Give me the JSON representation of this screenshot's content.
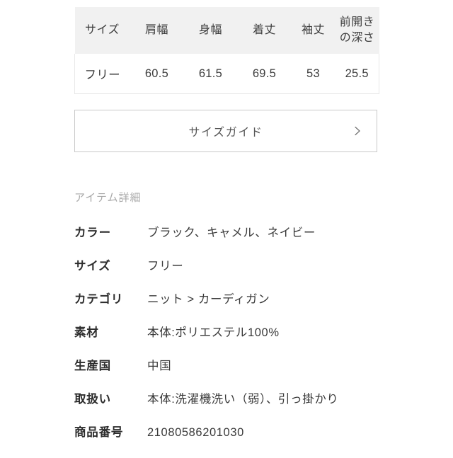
{
  "size_table": {
    "headers": [
      "サイズ",
      "肩幅",
      "身幅",
      "着丈",
      "袖丈",
      "前開きの深さ"
    ],
    "headers_line1": [
      "サイズ",
      "肩幅",
      "身幅",
      "着丈",
      "袖丈",
      "前開き"
    ],
    "headers_line2": [
      "",
      "",
      "",
      "",
      "",
      "の深さ"
    ],
    "rows": [
      [
        "フリー",
        "60.5",
        "61.5",
        "69.5",
        "53",
        "25.5"
      ]
    ],
    "header_bg": "#f1f1f1",
    "border_color": "#e4e4e4"
  },
  "size_guide_button": {
    "label": "サイズガイド",
    "icon": "chevron-right-icon",
    "border_color": "#c9c9c9"
  },
  "item_detail": {
    "heading": "アイテム詳細",
    "heading_color": "#a8a8a8",
    "rows": [
      {
        "label": "カラー",
        "value": "ブラック、キャメル、ネイビー"
      },
      {
        "label": "サイズ",
        "value": "フリー"
      },
      {
        "label": "カテゴリ",
        "value": "ニット > カーディガン"
      },
      {
        "label": "素材",
        "value": "本体:ポリエステル100%"
      },
      {
        "label": "生産国",
        "value": "中国"
      },
      {
        "label": "取扱い",
        "value": "本体:洗濯機洗い（弱）、引っ掛かり"
      },
      {
        "label": "商品番号",
        "value": "21080586201030"
      }
    ]
  }
}
